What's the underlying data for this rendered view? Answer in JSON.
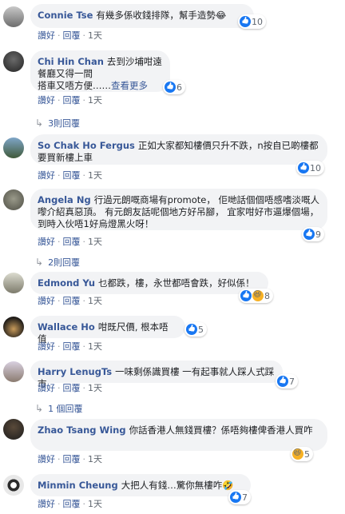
{
  "comments": [
    {
      "author": "Connie Tse",
      "text": "有幾多係收錢排隊，幫手造勢😂",
      "reaction_count": "10",
      "like_label": "讚好",
      "reply_label": "回覆",
      "time": "1天"
    },
    {
      "author": "Chi Hin Chan",
      "text_line1": "去到沙埔咁遠",
      "text_line2": "餐廳又得一間",
      "text_line3": "搭車又唔方便……",
      "see_more": "查看更多",
      "reaction_count": "6",
      "like_label": "讚好",
      "reply_label": "回覆",
      "time": "1天",
      "replies_label": "3則回覆"
    },
    {
      "author": "So Chak Ho Fergus",
      "text": "正如大家都知樓價只升不跌，n按自已啲樓都要買新樓上車",
      "reaction_count": "10",
      "like_label": "讚好",
      "reply_label": "回覆",
      "time": "1天"
    },
    {
      "author": "Angela Ng",
      "text": "行過元朗嘅商場有promote， 佢哋話個個唔感嗜淡嘅人嚟介紹真惡頂。 有元朗友話呢個地方好吊腳， 宜家咁好市逼爆個場， 到時入伙唔1好烏燈黑火呀！",
      "reaction_count": "9",
      "like_label": "讚好",
      "reply_label": "回覆",
      "time": "1天",
      "replies_label": "2則回覆"
    },
    {
      "author": "Edmond Yu",
      "text": "乜都跌，樓，永世都唔會跌，好似係！",
      "reaction_count": "8",
      "like_label": "讚好",
      "reply_label": "回覆",
      "time": "1天"
    },
    {
      "author": "Wallace Ho",
      "text": "咁既尺價, 根本唔值",
      "reaction_count": "5",
      "like_label": "讚好",
      "reply_label": "回覆",
      "time": "1天"
    },
    {
      "author": "Harry LenugTs",
      "text": "一味剩係識買樓 一有起事就人踩人式踩市",
      "reaction_count": "7",
      "like_label": "讚好",
      "reply_label": "回覆",
      "time": "1天",
      "replies_label": "1 個回覆"
    },
    {
      "author": "Zhao Tsang Wing",
      "text": "你話香港人無錢買樓？係唔夠樓俾香港人買咋",
      "reaction_count": "5",
      "like_label": "讚好",
      "reply_label": "回覆",
      "time": "1天"
    },
    {
      "author": "Minmin Cheung",
      "text": "大把人有錢…驚你無樓咋🤣",
      "reaction_count": "7",
      "like_label": "讚好",
      "reply_label": "回覆",
      "time": "1天"
    }
  ]
}
